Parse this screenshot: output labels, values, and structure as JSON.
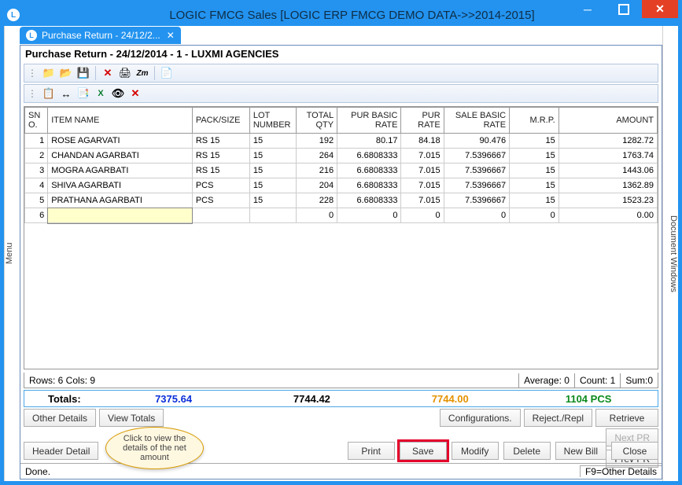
{
  "window": {
    "title": "LOGIC FMCG Sales  [LOGIC ERP FMCG DEMO DATA->>2014-2015]"
  },
  "rails": {
    "left": "Menu",
    "right": "Document Windows"
  },
  "tab": {
    "label": "Purchase Return - 24/12/2..."
  },
  "doc_title": "Purchase Return - 24/12/2014 - 1 - LUXMI AGENCIES",
  "grid": {
    "headers": {
      "sno": "SN O.",
      "item": "ITEM NAME",
      "pack": "PACK/SIZE",
      "lot": "LOT NUMBER",
      "qty": "TOTAL QTY",
      "pbr": "PUR BASIC RATE",
      "pr": "PUR RATE",
      "sbr": "SALE BASIC RATE",
      "mrp": "M.R.P.",
      "amt": "AMOUNT"
    },
    "rows": [
      {
        "sno": "1",
        "item": "ROSE AGARVATI",
        "pack": "RS 15",
        "lot": "15",
        "qty": "192",
        "pbr": "80.17",
        "pr": "84.18",
        "sbr": "90.476",
        "mrp": "15",
        "amt": "1282.72"
      },
      {
        "sno": "2",
        "item": "CHANDAN AGARBATI",
        "pack": "RS 15",
        "lot": "15",
        "qty": "264",
        "pbr": "6.6808333",
        "pr": "7.015",
        "sbr": "7.5396667",
        "mrp": "15",
        "amt": "1763.74"
      },
      {
        "sno": "3",
        "item": "MOGRA AGARBATI",
        "pack": "RS 15",
        "lot": "15",
        "qty": "216",
        "pbr": "6.6808333",
        "pr": "7.015",
        "sbr": "7.5396667",
        "mrp": "15",
        "amt": "1443.06"
      },
      {
        "sno": "4",
        "item": "SHIVA AGARBATI",
        "pack": "PCS",
        "lot": "15",
        "qty": "204",
        "pbr": "6.6808333",
        "pr": "7.015",
        "sbr": "7.5396667",
        "mrp": "15",
        "amt": "1362.89"
      },
      {
        "sno": "5",
        "item": "PRATHANA AGARBATI",
        "pack": "PCS",
        "lot": "15",
        "qty": "228",
        "pbr": "6.6808333",
        "pr": "7.015",
        "sbr": "7.5396667",
        "mrp": "15",
        "amt": "1523.23"
      },
      {
        "sno": "6",
        "item": "",
        "pack": "",
        "lot": "",
        "qty": "0",
        "pbr": "0",
        "pr": "0",
        "sbr": "0",
        "mrp": "0",
        "amt": "0.00"
      }
    ]
  },
  "status1": {
    "left": "Rows: 6  Cols: 9",
    "avg": "Average: 0",
    "cnt": "Count: 1",
    "sum": "Sum:0"
  },
  "totals": {
    "label": "Totals:",
    "v1": "7375.64",
    "v2": "7744.42",
    "v3": "7744.00",
    "v4": "1104 PCS"
  },
  "buttons1": {
    "other": "Other Details",
    "viewt": "View Totals",
    "cfg": "Configurations.",
    "rej": "Reject./Repl",
    "ret": "Retrieve",
    "nextpr": "Next PR",
    "prevpr": "Prev PR"
  },
  "buttons2": {
    "header": "Header Detail",
    "print": "Print",
    "save": "Save",
    "modify": "Modify",
    "delete": "Delete",
    "newbill": "New Bill",
    "close": "Close"
  },
  "bottom": {
    "left": "Done.",
    "right": "F9=Other Details"
  },
  "callout": "Click to view the details of the net amount"
}
